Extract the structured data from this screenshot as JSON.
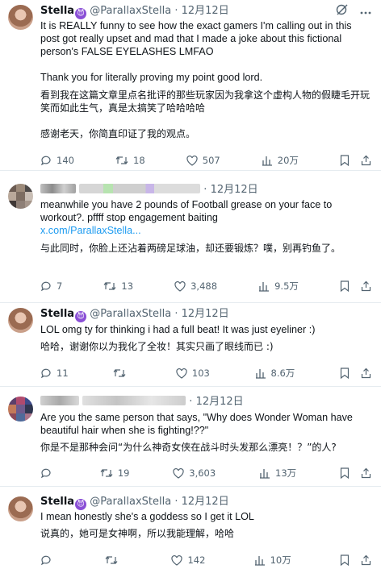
{
  "tweets": [
    {
      "name": "Stella",
      "handle": "@ParallaxStella",
      "dot": "·",
      "date": "12月12日",
      "paragraphs": [
        "It is REALLY funny to see how the exact gamers I'm calling out in this post got really upset and mad that I made a joke about this fictional person's FALSE EYELASHES LMFAO",
        "Thank you for literally proving my point good lord.",
        "看到我在这篇文章里点名批评的那些玩家因为我拿这个虚构人物的假睫毛开玩笑而如此生气，真是太搞笑了哈哈哈哈",
        "感谢老天，你简直印证了我的观点。"
      ],
      "stats": {
        "replies": "140",
        "reposts": "18",
        "likes": "507",
        "views": "20万"
      }
    },
    {
      "name": "",
      "handle": "",
      "dot": "·",
      "date": "12月12日",
      "paragraphs": [
        "meanwhile you have 2 pounds of Football grease on your face to workout?. pffff  stop engagement baiting",
        "x.com/ParallaxStella...",
        "与此同时，你脸上还沾着两磅足球油，却还要锻炼？噗，别再钓鱼了。"
      ],
      "stats": {
        "replies": "7",
        "reposts": "13",
        "likes": "3,488",
        "views": "9.5万"
      }
    },
    {
      "name": "Stella",
      "handle": "@ParallaxStella",
      "dot": "·",
      "date": "12月12日",
      "paragraphs": [
        "LOL omg ty for thinking i had a full beat! It was just eyeliner :)",
        "哈哈，谢谢你以为我化了全妆！其实只画了眼线而已 :)"
      ],
      "stats": {
        "replies": "11",
        "reposts": "",
        "likes": "103",
        "views": "8.6万"
      }
    },
    {
      "name": "",
      "handle": "",
      "dot": "·",
      "date": "12月12日",
      "paragraphs": [
        "Are you the same person that says, \"Why does Wonder Woman have beautiful hair when she is fighting!??\"",
        "你是不是那种会问“为什么神奇女侠在战斗时头发那么漂亮！？”的人?"
      ],
      "stats": {
        "replies": "",
        "reposts": "19",
        "likes": "3,603",
        "views": "13万"
      }
    },
    {
      "name": "Stella",
      "handle": "@ParallaxStella",
      "dot": "·",
      "date": "12月12日",
      "paragraphs": [
        "I mean honestly she's a goddess so I get it LOL",
        "说真的，她可是女神啊，所以我能理解，哈哈"
      ],
      "stats": {
        "replies": "",
        "reposts": "",
        "likes": "142",
        "views": "10万"
      }
    }
  ],
  "icons": {
    "reply": "reply-icon",
    "repost": "repost-icon",
    "like": "like-icon",
    "views": "views-icon",
    "bookmark": "bookmark-icon",
    "share": "share-icon",
    "grok": "grok-icon",
    "more": "more-icon",
    "badge": "verified-badge-icon"
  },
  "colors": {
    "text": "#0f1419",
    "secondary": "#536471",
    "link": "#1d9bf0",
    "badge": "#8a4fd6",
    "divider": "#e6ecf0"
  }
}
